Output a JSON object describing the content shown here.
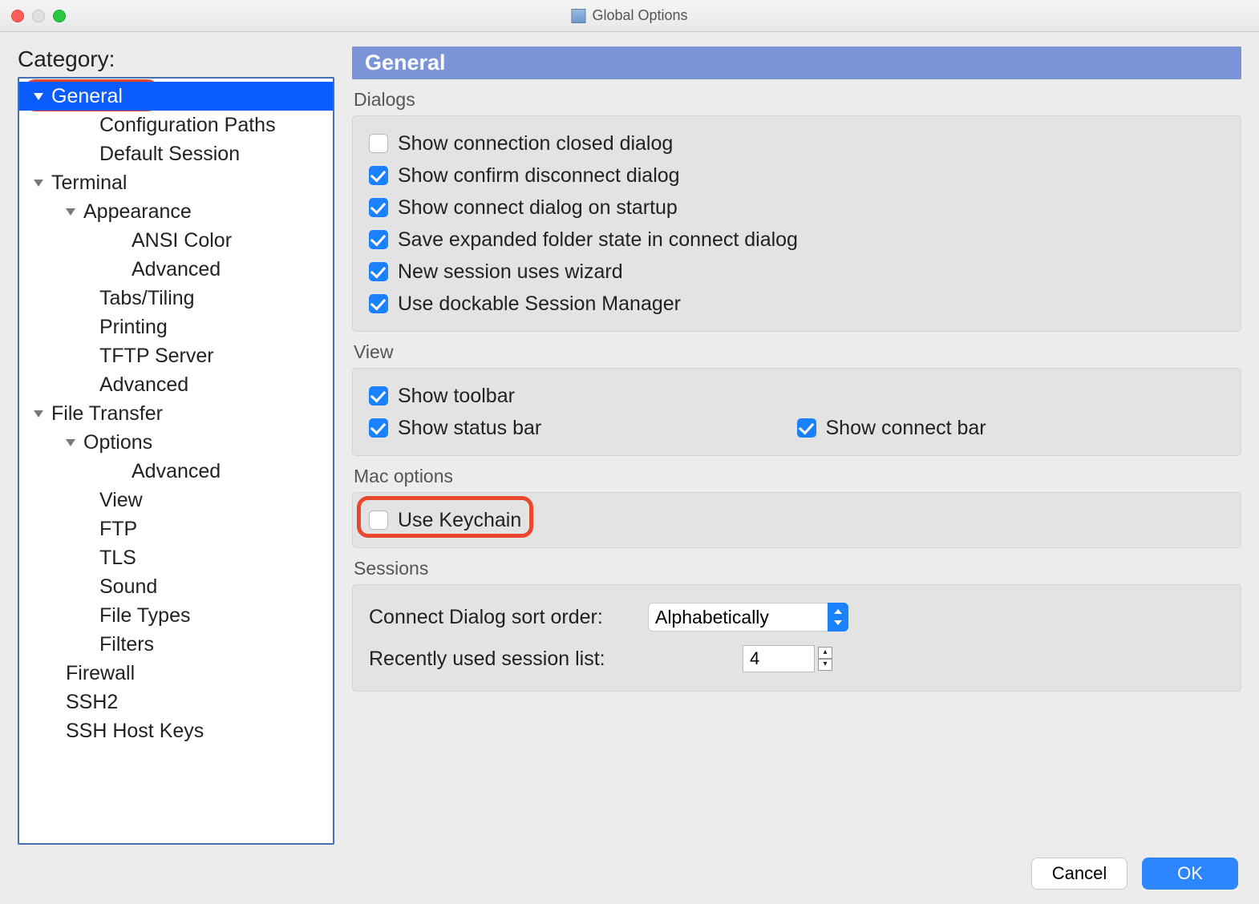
{
  "window": {
    "title": "Global Options"
  },
  "sidebar": {
    "heading": "Category:",
    "tree": {
      "general": "General",
      "config_paths": "Configuration Paths",
      "default_session": "Default Session",
      "terminal": "Terminal",
      "appearance": "Appearance",
      "ansi_color": "ANSI Color",
      "app_advanced": "Advanced",
      "tabs_tiling": "Tabs/Tiling",
      "printing": "Printing",
      "tftp": "TFTP Server",
      "term_advanced": "Advanced",
      "file_transfer": "File Transfer",
      "options": "Options",
      "ft_advanced": "Advanced",
      "view": "View",
      "ftp": "FTP",
      "tls": "TLS",
      "sound": "Sound",
      "file_types": "File Types",
      "filters": "Filters",
      "firewall": "Firewall",
      "ssh2": "SSH2",
      "ssh_host_keys": "SSH Host Keys"
    }
  },
  "panel": {
    "title": "General",
    "dialogs": {
      "label": "Dialogs",
      "show_closed": "Show connection closed dialog",
      "show_confirm": "Show confirm disconnect dialog",
      "show_startup": "Show connect dialog on startup",
      "save_expanded": "Save expanded folder state in connect dialog",
      "new_wizard": "New session uses wizard",
      "dockable": "Use dockable Session Manager"
    },
    "view": {
      "label": "View",
      "toolbar": "Show toolbar",
      "statusbar": "Show status bar",
      "connectbar": "Show connect bar"
    },
    "mac": {
      "label": "Mac options",
      "keychain": "Use Keychain"
    },
    "sessions": {
      "label": "Sessions",
      "sort_label": "Connect Dialog sort order:",
      "sort_value": "Alphabetically",
      "recent_label": "Recently used session list:",
      "recent_value": "4"
    }
  },
  "footer": {
    "cancel": "Cancel",
    "ok": "OK"
  }
}
